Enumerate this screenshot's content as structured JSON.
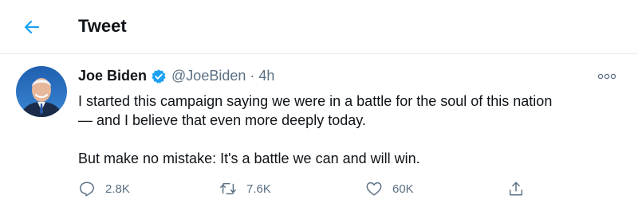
{
  "header": {
    "title": "Tweet",
    "back_icon": "arrow-left-icon"
  },
  "tweet": {
    "author_name": "Joe Biden",
    "verified_icon": "verified-badge-icon",
    "handle": "@JoeBiden",
    "separator": "·",
    "time": "4h",
    "more_icon": "more-options-icon",
    "text_para1_line1": "I started this campaign saying we were in a battle for the soul of this nation",
    "text_para1_line2": "— and I believe that even more deeply today.",
    "text_para2": "But make no mistake: It's a battle we can and will win.",
    "actions": {
      "replies": "2.8K",
      "retweets": "7.6K",
      "likes": "60K"
    }
  },
  "colors": {
    "accent": "#1da1f2",
    "text_primary": "#0f1419",
    "text_secondary": "#5b7083",
    "divider": "#e6ecf0"
  }
}
